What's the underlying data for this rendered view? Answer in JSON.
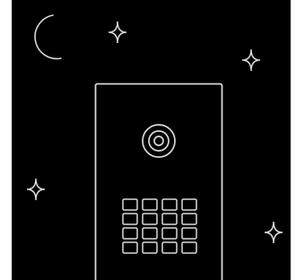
{
  "scene": {
    "subject": "doorbell-intercom",
    "icons": [
      "crescent-moon-icon",
      "sparkle-star-icon",
      "camera-lens-icon",
      "keypad-icon"
    ],
    "colors": {
      "background": "#000000",
      "line": "#d9d9d9",
      "page": "#ffffff"
    },
    "keypad": {
      "rows": 4,
      "columns": 4
    }
  }
}
